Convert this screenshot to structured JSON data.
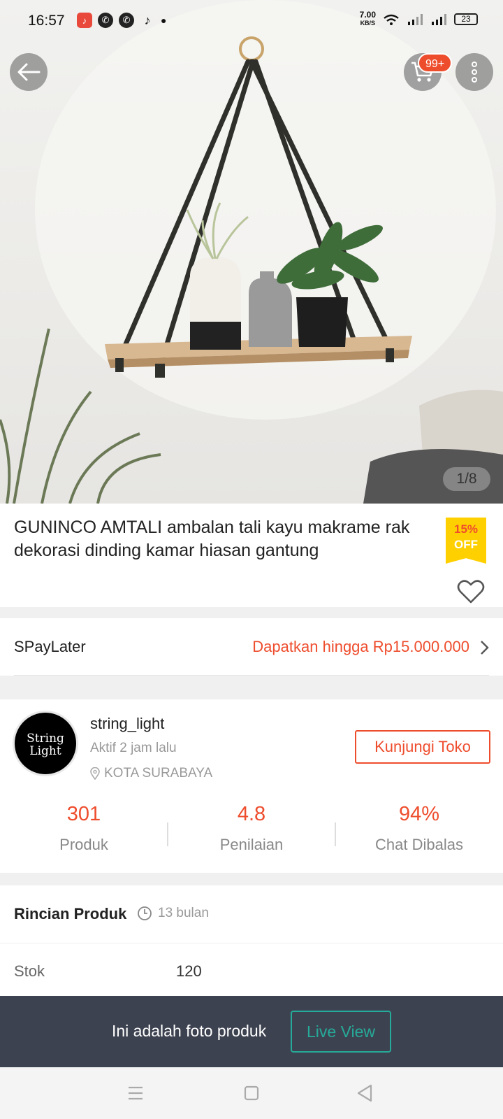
{
  "status_bar": {
    "time": "16:57",
    "net_speed_value": "7.00",
    "net_speed_unit": "KB/S",
    "battery": "23"
  },
  "image": {
    "counter": "1/8"
  },
  "header": {
    "cart_badge": "99+"
  },
  "product": {
    "title": "GUNINCO AMTALI ambalan tali kayu makrame rak dekorasi dinding kamar hiasan gantung",
    "discount_pct": "15%",
    "discount_word": "OFF"
  },
  "paylater": {
    "label": "SPayLater",
    "value": "Dapatkan hingga Rp15.000.000"
  },
  "shop": {
    "avatar_line1": "String",
    "avatar_line2": "Light",
    "name": "string_light",
    "active": "Aktif 2 jam lalu",
    "location": "KOTA SURABAYA",
    "visit_label": "Kunjungi Toko",
    "stats": [
      {
        "value": "301",
        "label": "Produk"
      },
      {
        "value": "4.8",
        "label": "Penilaian"
      },
      {
        "value": "94%",
        "label": "Chat Dibalas"
      }
    ]
  },
  "details": {
    "title": "Rincian Produk",
    "age": "13 bulan",
    "stock_label": "Stok",
    "stock_value": "120"
  },
  "live_banner": {
    "text": "Ini adalah foto produk",
    "button": "Live View"
  },
  "colors": {
    "accent": "#ee4d2d",
    "teal": "#26aa99",
    "badge_yellow": "#ffd000",
    "banner_bg": "#3d4250"
  },
  "icons": [
    "back-arrow-icon",
    "cart-icon",
    "more-vertical-icon",
    "heart-icon",
    "chevron-right-icon",
    "location-pin-icon",
    "clock-icon",
    "menu-icon",
    "home-square-icon",
    "back-triangle-icon"
  ]
}
